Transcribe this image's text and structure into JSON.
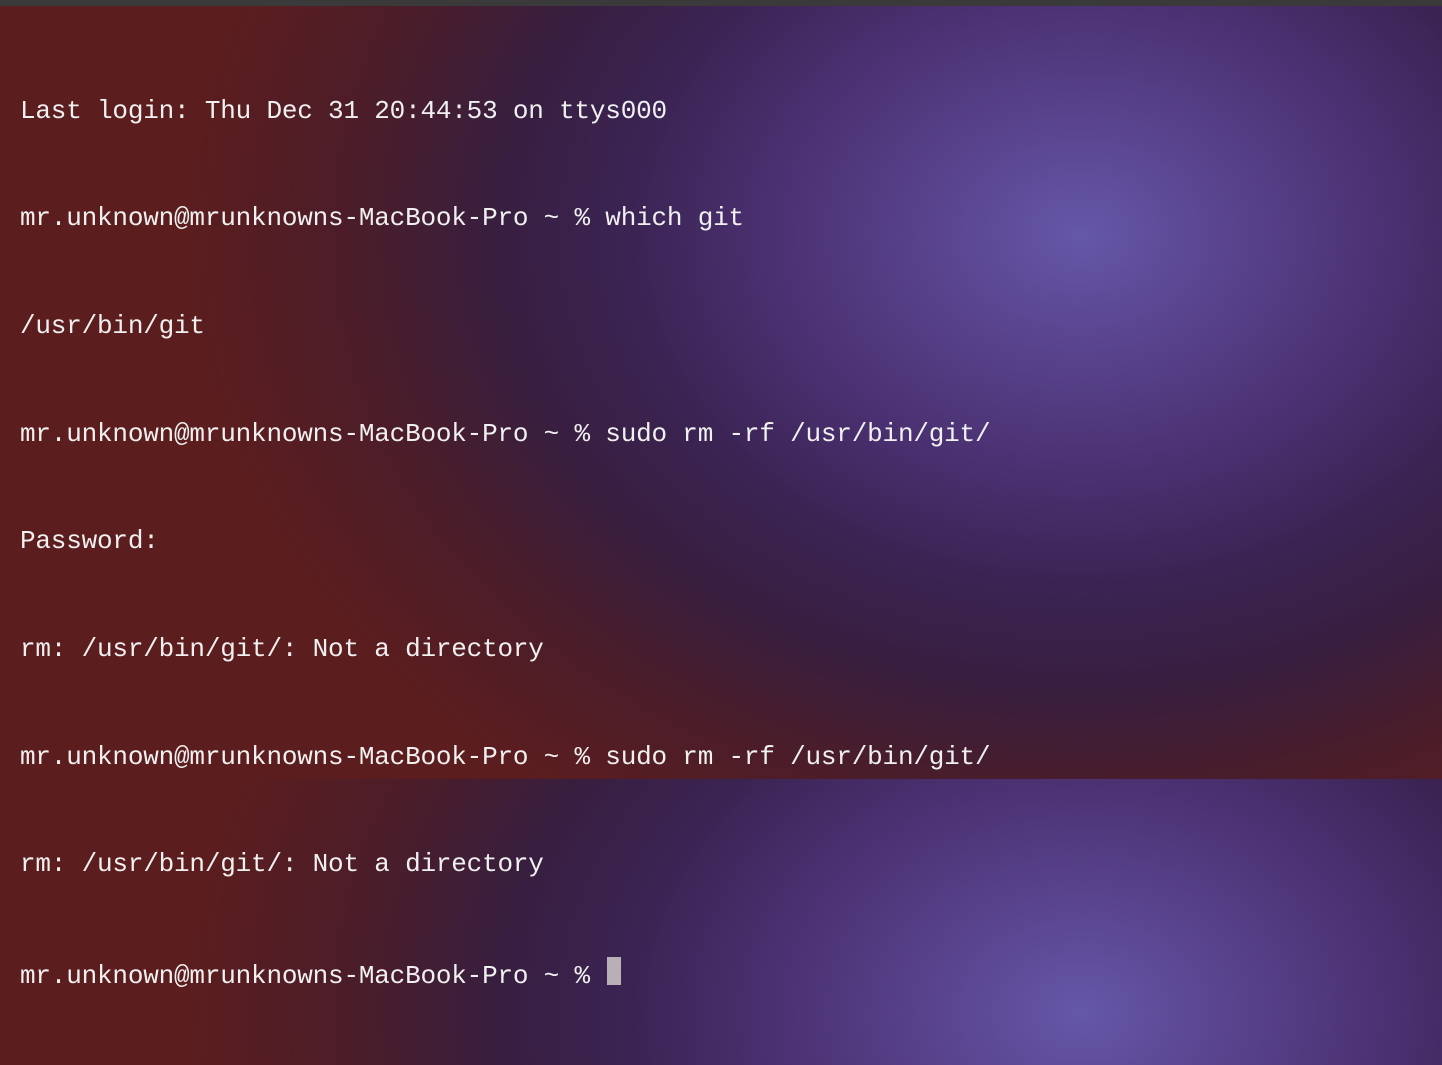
{
  "terminal": {
    "login_message": "Last login: Thu Dec 31 20:44:53 on ttys000",
    "prompt": "mr.unknown@mrunknowns-MacBook-Pro ~ % ",
    "lines": [
      {
        "type": "output",
        "text": "Last login: Thu Dec 31 20:44:53 on ttys000"
      },
      {
        "type": "command",
        "prompt": "mr.unknown@mrunknowns-MacBook-Pro ~ % ",
        "cmd": "which git"
      },
      {
        "type": "output",
        "text": "/usr/bin/git"
      },
      {
        "type": "command",
        "prompt": "mr.unknown@mrunknowns-MacBook-Pro ~ % ",
        "cmd": "sudo rm -rf /usr/bin/git/"
      },
      {
        "type": "output",
        "text": "Password:"
      },
      {
        "type": "output",
        "text": "rm: /usr/bin/git/: Not a directory"
      },
      {
        "type": "command",
        "prompt": "mr.unknown@mrunknowns-MacBook-Pro ~ % ",
        "cmd": "sudo rm -rf /usr/bin/git/"
      },
      {
        "type": "output",
        "text": "rm: /usr/bin/git/: Not a directory"
      },
      {
        "type": "active-prompt",
        "prompt": "mr.unknown@mrunknowns-MacBook-Pro ~ % ",
        "cmd": ""
      }
    ]
  }
}
